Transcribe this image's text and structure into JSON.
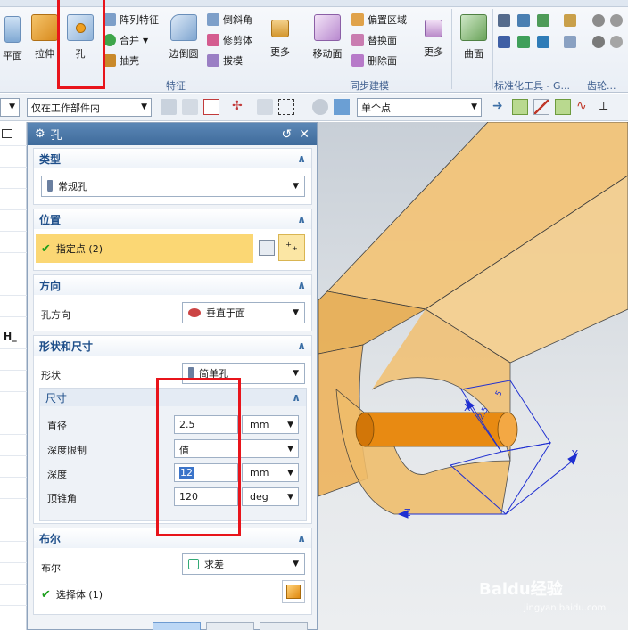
{
  "ribbon": {
    "groups": {
      "feature_label": "特征",
      "sync_label": "同步建模",
      "standard_label": "标准化工具 - G...",
      "gear_label": "齿轮..."
    },
    "buttons": {
      "plane": "平面",
      "extrude": "拉伸",
      "hole": "孔",
      "edge_blend": "边倒圆",
      "more1": "更多",
      "move_face": "移动面",
      "more2": "更多",
      "surface": "曲面"
    },
    "small": {
      "pattern_feature": "阵列特征",
      "unite": "合并",
      "shell": "抽壳",
      "chamfer": "倒斜角",
      "trim_body": "修剪体",
      "draft": "拔模",
      "offset_region": "偏置区域",
      "replace_face": "替换面",
      "delete_face": "删除面"
    }
  },
  "selbar": {
    "scope": "仅在工作部件内",
    "point_type": "单个点"
  },
  "dialog": {
    "title": "孔",
    "type_section": "类型",
    "type_value": "常规孔",
    "position_section": "位置",
    "specify_point": "指定点 (2)",
    "direction_section": "方向",
    "hole_direction_label": "孔方向",
    "hole_direction_value": "垂直于面",
    "shape_section": "形状和尺寸",
    "shape_label": "形状",
    "shape_value": "简单孔",
    "dimensions_section": "尺寸",
    "diameter_label": "直径",
    "diameter_value": "2.5",
    "diameter_unit": "mm",
    "depth_limit_label": "深度限制",
    "depth_limit_value": "值",
    "depth_label": "深度",
    "depth_value": "12",
    "depth_unit": "mm",
    "tip_angle_label": "顶锥角",
    "tip_angle_value": "120",
    "tip_angle_unit": "deg",
    "boolean_section": "布尔",
    "boolean_label": "布尔",
    "boolean_value": "求差",
    "select_body": "选择体 (1)"
  },
  "viewport": {
    "axis_x": "X",
    "axis_y": "Y",
    "axis_z": "Z",
    "dim_a": "2.5",
    "dim_b": "5",
    "watermark": "Baidu经验",
    "watermark_url": "jingyan.baidu.com"
  },
  "leftstrip": {
    "partial_text": "H_"
  },
  "colors": {
    "accent": "#3f6b9b",
    "highlight": "#fbd774",
    "part": "#f0b45a",
    "cylinder": "#e88a12",
    "annotation_red": "#e8141b"
  }
}
